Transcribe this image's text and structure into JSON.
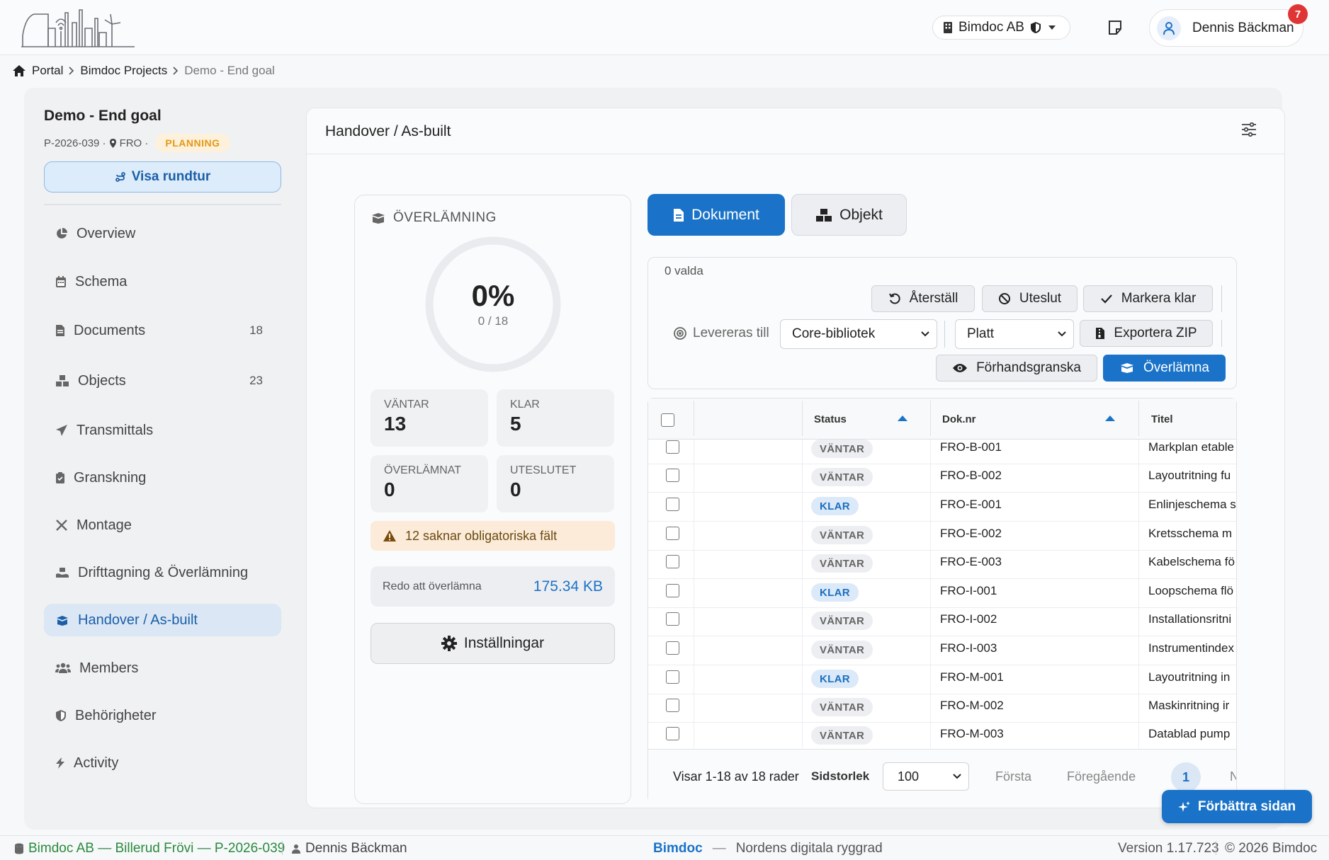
{
  "header": {
    "org_name": "Bimdoc AB",
    "user_name": "Dennis Bäckman",
    "notification_count": "7"
  },
  "breadcrumb": {
    "items": [
      "Portal",
      "Bimdoc Projects"
    ],
    "current": "Demo - End goal"
  },
  "project": {
    "title": "Demo - End goal",
    "code": "P-2026-039 ·",
    "location": "FRO ·",
    "status": "PLANNING",
    "tour_label": "Visa rundtur"
  },
  "sidebar": {
    "items": [
      {
        "label": "Overview",
        "icon": "pie-chart-icon"
      },
      {
        "label": "Schema",
        "icon": "calendar-icon"
      },
      {
        "label": "Documents",
        "count": "18",
        "icon": "file-icon"
      },
      {
        "label": "Objects",
        "count": "23",
        "icon": "cubes-icon"
      },
      {
        "label": "Transmittals",
        "icon": "paper-plane-icon"
      },
      {
        "label": "Granskning",
        "icon": "clipboard-check-icon"
      },
      {
        "label": "Montage",
        "icon": "tools-icon"
      },
      {
        "label": "Drifttagning & Överlämning",
        "icon": "hand-holding-icon"
      },
      {
        "label": "Handover / As-built",
        "icon": "box-open-icon",
        "active": true
      },
      {
        "label": "Members",
        "icon": "users-icon"
      },
      {
        "label": "Behörigheter",
        "icon": "shield-icon"
      },
      {
        "label": "Activity",
        "icon": "bolt-icon"
      }
    ]
  },
  "panel": {
    "title": "Handover / As-built"
  },
  "summary": {
    "heading": "ÖVERLÄMNING",
    "percent": "0%",
    "progress_text": "0 / 18",
    "progress_fraction": 0,
    "stats": [
      {
        "label": "VÄNTAR",
        "value": "13"
      },
      {
        "label": "KLAR",
        "value": "5"
      },
      {
        "label": "ÖVERLÄMNAT",
        "value": "0"
      },
      {
        "label": "UTESLUTET",
        "value": "0"
      }
    ],
    "warning": "12 saknar obligatoriska fält",
    "ready_label": "Redo att överlämna",
    "ready_size": "175.34 KB",
    "settings_label": "Inställningar"
  },
  "tabs": {
    "documents": "Dokument",
    "objects": "Objekt"
  },
  "toolbar": {
    "selected": "0 valda",
    "reset": "Återställ",
    "exclude": "Uteslut",
    "mark_done": "Markera klar",
    "deliver_label": "Levereras till",
    "deliver_value": "Core-bibliotek",
    "structure_value": "Platt",
    "export_zip": "Exportera ZIP",
    "preview": "Förhandsgranska",
    "handover": "Överlämna"
  },
  "table": {
    "columns": {
      "status": "Status",
      "doc_no": "Dok.nr",
      "title": "Titel"
    },
    "rows": [
      {
        "status": "VÄNTAR",
        "doc": "FRO-B-001",
        "title": "Markplan etable"
      },
      {
        "status": "VÄNTAR",
        "doc": "FRO-B-002",
        "title": "Layoutritning fu"
      },
      {
        "status": "KLAR",
        "doc": "FRO-E-001",
        "title": "Enlinjeschema s"
      },
      {
        "status": "VÄNTAR",
        "doc": "FRO-E-002",
        "title": "Kretsschema m"
      },
      {
        "status": "VÄNTAR",
        "doc": "FRO-E-003",
        "title": "Kabelschema fö"
      },
      {
        "status": "KLAR",
        "doc": "FRO-I-001",
        "title": "Loopschema flö"
      },
      {
        "status": "VÄNTAR",
        "doc": "FRO-I-002",
        "title": "Installationsritni"
      },
      {
        "status": "VÄNTAR",
        "doc": "FRO-I-003",
        "title": "Instrumentindex"
      },
      {
        "status": "KLAR",
        "doc": "FRO-M-001",
        "title": "Layoutritning in"
      },
      {
        "status": "VÄNTAR",
        "doc": "FRO-M-002",
        "title": "Maskinritning ir"
      },
      {
        "status": "VÄNTAR",
        "doc": "FRO-M-003",
        "title": "Datablad pump"
      }
    ]
  },
  "pager": {
    "info": "Visar 1-18 av 18 rader",
    "page_size_label": "Sidstorlek",
    "page_size": "100",
    "first": "Första",
    "prev": "Föregående",
    "current": "1",
    "next_partial": "N"
  },
  "fab": {
    "label": "Förbättra sidan"
  },
  "footer": {
    "org_project": "Bimdoc AB — Billerud Frövi — P-2026-039",
    "user": "Dennis Bäckman",
    "brand": "Bimdoc",
    "dash": "—",
    "tagline": "Nordens digitala ryggrad",
    "version": "Version 1.17.723",
    "copyright": "© 2026 Bimdoc"
  },
  "colors": {
    "primary": "#1a73c8",
    "planning": "#e29a18",
    "warning_bg": "#fbebd8",
    "footer_green": "#2a8a3e",
    "notification": "#e03535"
  }
}
